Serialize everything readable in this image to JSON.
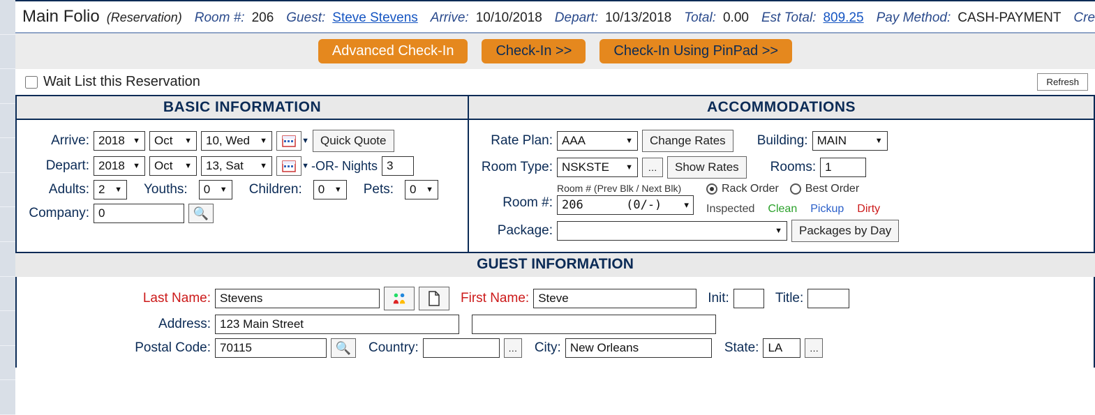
{
  "summary": {
    "title": "Main Folio",
    "paren": "(Reservation)",
    "room_lbl": "Room #:",
    "room_val": "206",
    "guest_lbl": "Guest:",
    "guest_link": "Steve Stevens",
    "arrive_lbl": "Arrive:",
    "arrive_val": "10/10/2018",
    "depart_lbl": "Depart:",
    "depart_val": "10/13/2018",
    "total_lbl": "Total:",
    "total_val": "0.00",
    "est_total_lbl": "Est Total:",
    "est_total_link": "809.25",
    "pay_lbl": "Pay Method:",
    "pay_val": "CASH-PAYMENT",
    "credit_lbl": "Credit Li"
  },
  "buttons": {
    "adv_checkin": "Advanced Check-In",
    "checkin": "Check-In >>",
    "checkin_pinpad": "Check-In Using PinPad >>"
  },
  "wait": {
    "label": "Wait List this Reservation",
    "refresh": "Refresh"
  },
  "basic": {
    "heading": "BASIC INFORMATION",
    "arrive_lbl": "Arrive:",
    "arrive_y": "2018",
    "arrive_m": "Oct",
    "arrive_d": "10, Wed",
    "quick_quote": "Quick Quote",
    "depart_lbl": "Depart:",
    "depart_y": "2018",
    "depart_m": "Oct",
    "depart_d": "13, Sat",
    "or_nights": "-OR- Nights",
    "nights": "3",
    "adults_lbl": "Adults:",
    "adults": "2",
    "youths_lbl": "Youths:",
    "youths": "0",
    "children_lbl": "Children:",
    "children": "0",
    "pets_lbl": "Pets:",
    "pets": "0",
    "company_lbl": "Company:",
    "company": "0"
  },
  "acc": {
    "heading": "ACCOMMODATIONS",
    "rate_plan_lbl": "Rate Plan:",
    "rate_plan": "AAA",
    "change_rates": "Change Rates",
    "building_lbl": "Building:",
    "building": "MAIN",
    "room_type_lbl": "Room Type:",
    "room_type": "NSKSTE",
    "show_rates": "Show Rates",
    "rooms_lbl": "Rooms:",
    "rooms": "1",
    "room_no_lbl": "Room #:",
    "room_no_hint": "Room # (Prev Blk / Next Blk)",
    "room_no_val": "206      (0/-)",
    "rack_order": "Rack Order",
    "best_order": "Best Order",
    "inspected": "Inspected",
    "clean": "Clean",
    "pickup": "Pickup",
    "dirty": "Dirty",
    "package_lbl": "Package:",
    "packages_by_day": "Packages by Day"
  },
  "guest": {
    "heading": "GUEST INFORMATION",
    "last_name_lbl": "Last Name:",
    "last_name": "Stevens",
    "first_name_lbl": "First Name:",
    "first_name": "Steve",
    "init_lbl": "Init:",
    "init": "",
    "title_lbl": "Title:",
    "title": "",
    "address_lbl": "Address:",
    "address": "123 Main Street",
    "address2": "",
    "postal_lbl": "Postal Code:",
    "postal": "70115",
    "country_lbl": "Country:",
    "country": "",
    "city_lbl": "City:",
    "city": "New Orleans",
    "state_lbl": "State:",
    "state": "LA"
  }
}
